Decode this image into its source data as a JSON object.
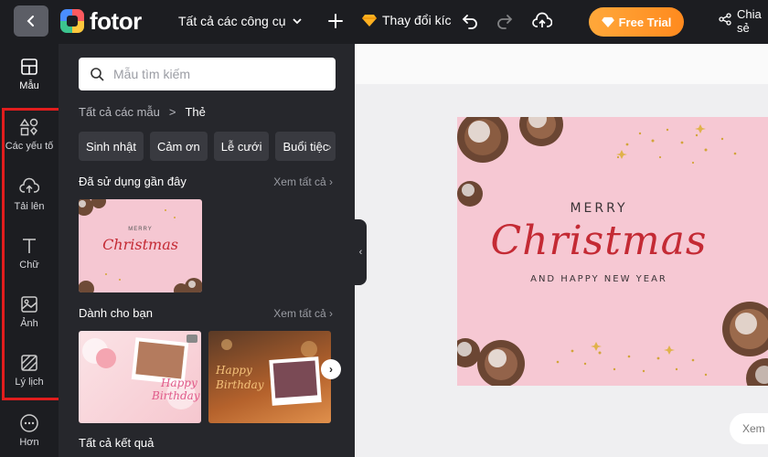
{
  "topbar": {
    "logo_text": "fotor",
    "tools_menu_label": "Tất cả các công cụ",
    "resize_label": "Thay đổi kíc",
    "trial_label": "Free Trial",
    "share_label_line1": "Chia",
    "share_label_line2": "sẻ"
  },
  "rail": {
    "items": [
      {
        "label": "Mẫu",
        "icon": "layout-icon"
      },
      {
        "label": "Các yếu tố",
        "icon": "shapes-icon"
      },
      {
        "label": "Tải lên",
        "icon": "upload-icon"
      },
      {
        "label": "Chữ",
        "icon": "text-icon"
      },
      {
        "label": "Ảnh",
        "icon": "image-icon"
      },
      {
        "label": "Lý lịch",
        "icon": "background-icon"
      },
      {
        "label": "Hơn",
        "icon": "more-icon"
      }
    ],
    "highlight_color": "#e11d1d"
  },
  "panel": {
    "search_placeholder": "Mẫu tìm kiếm",
    "breadcrumb_root": "Tất cả các mẫu",
    "breadcrumb_sep": ">",
    "breadcrumb_current": "Thẻ",
    "chips": [
      "Sinh nhật",
      "Cảm ơn",
      "Lễ cưới",
      "Buổi tiệc"
    ],
    "recent_title": "Đã sử dụng gần đây",
    "recent_see_all": "Xem tất cả",
    "for_you_title": "Dành cho bạn",
    "for_you_see_all": "Xem tất cả",
    "all_results_title": "Tất cả kết quả",
    "thumb_christmas": {
      "line1": "MERRY",
      "line2": "Christmas"
    },
    "thumb_bday1": {
      "line1": "Happy",
      "line2": "Birthday"
    },
    "thumb_bday2": {
      "line1": "Happy",
      "line2": "Birthday"
    }
  },
  "canvas": {
    "line1": "MERRY",
    "line2": "Christmas",
    "line3": "AND HAPPY NEW YEAR",
    "zoom_label": "Xem",
    "card_color": "#f6c8d3",
    "accent_red": "#c42a34"
  },
  "colors": {
    "trial_gradient_start": "#ffa83a",
    "trial_gradient_end": "#ff8a1e",
    "panel_bg": "#26272c",
    "topbar_bg": "#1c1d21"
  }
}
